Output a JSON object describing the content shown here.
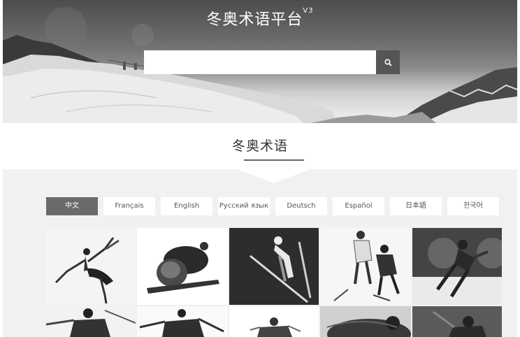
{
  "header": {
    "title": "冬奥术语平台",
    "version": "V3",
    "search": {
      "value": "",
      "placeholder": ""
    },
    "search_icon": "search-icon"
  },
  "section": {
    "title": "冬奥术语"
  },
  "languages": [
    {
      "label": "中文",
      "active": true
    },
    {
      "label": "Français",
      "active": false
    },
    {
      "label": "English",
      "active": false
    },
    {
      "label": "Русский язык",
      "active": false
    },
    {
      "label": "Deutsch",
      "active": false
    },
    {
      "label": "Español",
      "active": false
    },
    {
      "label": "日本語",
      "active": false
    },
    {
      "label": "한국어",
      "active": false
    }
  ],
  "sport_tiles": [
    {
      "sport": "figure-skating"
    },
    {
      "sport": "skeleton"
    },
    {
      "sport": "ski-jumping"
    },
    {
      "sport": "ice-hockey"
    },
    {
      "sport": "speed-skating"
    },
    {
      "sport": "biathlon"
    },
    {
      "sport": "cross-country-skiing"
    },
    {
      "sport": "freestyle-skiing"
    },
    {
      "sport": "luge"
    },
    {
      "sport": "short-track"
    }
  ],
  "colors": {
    "active_tab": "#6a6a6a",
    "band": "#f1f1f1",
    "search_button": "#555555"
  }
}
